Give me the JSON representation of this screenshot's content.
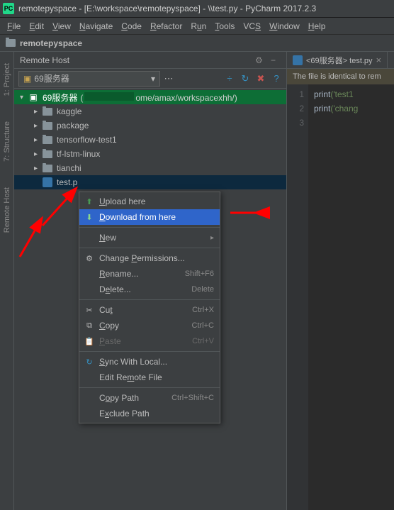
{
  "window": {
    "title": "remotepyspace - [E:\\workspace\\remotepyspace] - \\\\test.py - PyCharm 2017.2.3"
  },
  "menubar": [
    "File",
    "Edit",
    "View",
    "Navigate",
    "Code",
    "Refactor",
    "Run",
    "Tools",
    "VCS",
    "Window",
    "Help"
  ],
  "breadcrumb": {
    "project": "remotepyspace"
  },
  "left_tabs": [
    "1: Project",
    "7: Structure",
    "Remote Host"
  ],
  "remote_host": {
    "title": "Remote Host",
    "server": "69服务器",
    "root": {
      "label": "69服务器",
      "path_suffix": "ome/amax/workspacexhh/)"
    },
    "items": [
      {
        "label": "kaggle"
      },
      {
        "label": "package"
      },
      {
        "label": "tensorflow-test1"
      },
      {
        "label": "tf-lstm-linux"
      },
      {
        "label": "tianchi"
      }
    ],
    "file": {
      "label": "test.p"
    }
  },
  "editor": {
    "tab": "<69服务器> test.py",
    "info": "The file is identical to rem",
    "gutter": [
      "1",
      "2",
      "3"
    ],
    "code": {
      "line1_fn": "print",
      "line1_arg": "('test1",
      "line2_fn": "print",
      "line2_arg": "('chang"
    }
  },
  "context_menu": {
    "upload": "Upload here",
    "download": "Download from here",
    "new": "New",
    "perms": "Change Permissions...",
    "rename": "Rename...",
    "rename_key": "Shift+F6",
    "delete": "Delete...",
    "delete_key": "Delete",
    "cut": "Cut",
    "cut_key": "Ctrl+X",
    "copy": "Copy",
    "copy_key": "Ctrl+C",
    "paste": "Paste",
    "paste_key": "Ctrl+V",
    "sync": "Sync With Local...",
    "editremote": "Edit Remote File",
    "copypath": "Copy Path",
    "copypath_key": "Ctrl+Shift+C",
    "exclude": "Exclude Path"
  }
}
